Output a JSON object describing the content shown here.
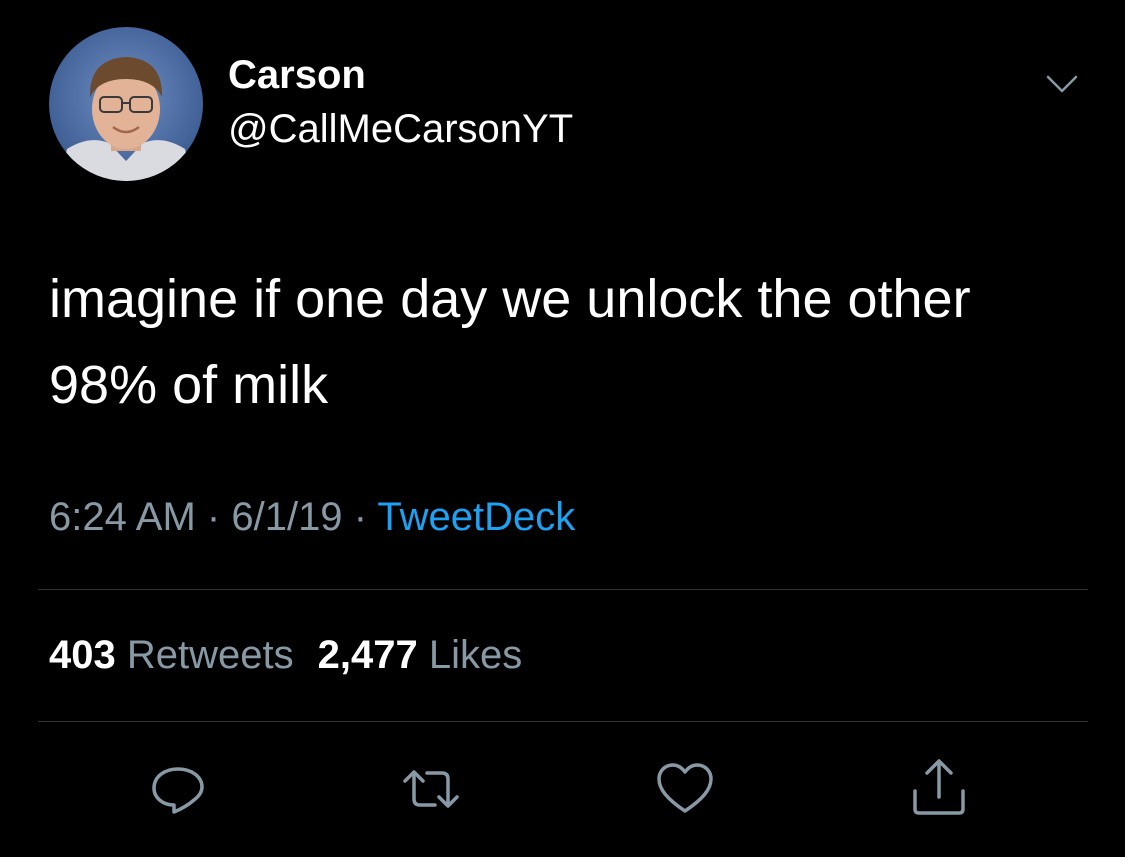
{
  "tweet": {
    "author": {
      "display_name": "Carson",
      "handle": "@CallMeCarsonYT"
    },
    "text_lines": [
      "imagine if one day we unlock the other",
      "98% of milk"
    ],
    "time": "6:24 AM",
    "date": "6/1/19",
    "separator": "·",
    "source": "TweetDeck",
    "retweets_count": "403",
    "retweets_label": "Retweets",
    "likes_count": "2,477",
    "likes_label": "Likes"
  },
  "icons": {
    "options": "chevron-down-icon",
    "reply": "reply-icon",
    "retweet": "retweet-icon",
    "like": "heart-icon",
    "share": "share-icon"
  },
  "colors": {
    "background": "#000000",
    "text": "#ffffff",
    "muted": "#8899a6",
    "link": "#1da1f2",
    "divider": "#2f3336"
  }
}
